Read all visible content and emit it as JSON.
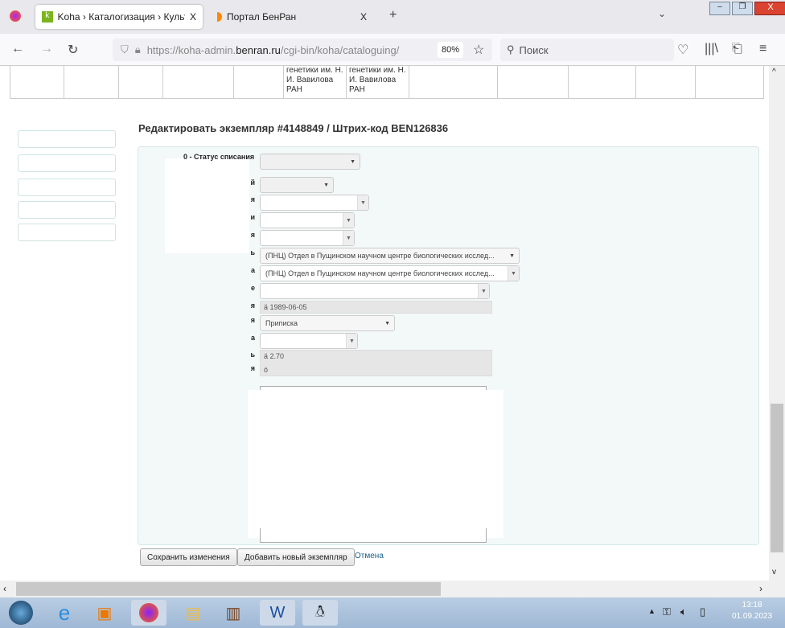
{
  "browser": {
    "tabs": [
      {
        "label": "Koha › Каталогизация › Культу",
        "close": "X"
      },
      {
        "label": "Портал БенРан",
        "close": "X"
      }
    ],
    "new_tab": "+",
    "url_prefix": "https://koha-admin.",
    "url_domain": "benran.ru",
    "url_path": "/cgi-bin/koha/cataloguing/",
    "zoom": "80%",
    "search_placeholder": "Поиск"
  },
  "table_row": {
    "cells": [
      "генетики им. Н. И. Вавилова РАН",
      "генетики им. Н. И. Вавилова РАН"
    ]
  },
  "page": {
    "title": "Редактировать экземпляр #4148849 / Штрих-код BEN126836"
  },
  "form": {
    "first_label": "0 - Статус списания",
    "rows": [
      {
        "label": "й"
      },
      {
        "label": "я"
      },
      {
        "label": "и"
      },
      {
        "label": "я"
      },
      {
        "label": "ь",
        "value": "(ПНЦ) Отдел в Пущинском научном центре биологических исслед..."
      },
      {
        "label": "а",
        "value": "(ПНЦ) Отдел в Пущинском научном центре биологических исслед..."
      },
      {
        "label": "е"
      },
      {
        "label": "я",
        "value": "ä 1989-06-05"
      },
      {
        "label": "я",
        "value": "Приписка"
      },
      {
        "label": "а"
      },
      {
        "label": "ь",
        "value": "ä 2.70"
      },
      {
        "label": "я",
        "value": "ö"
      }
    ],
    "save": "Сохранить изменения",
    "add": "Добавить новый экземпляр",
    "cancel": "Отмена"
  },
  "taskbar": {
    "time": "13:18",
    "date": "01.09.2023"
  }
}
